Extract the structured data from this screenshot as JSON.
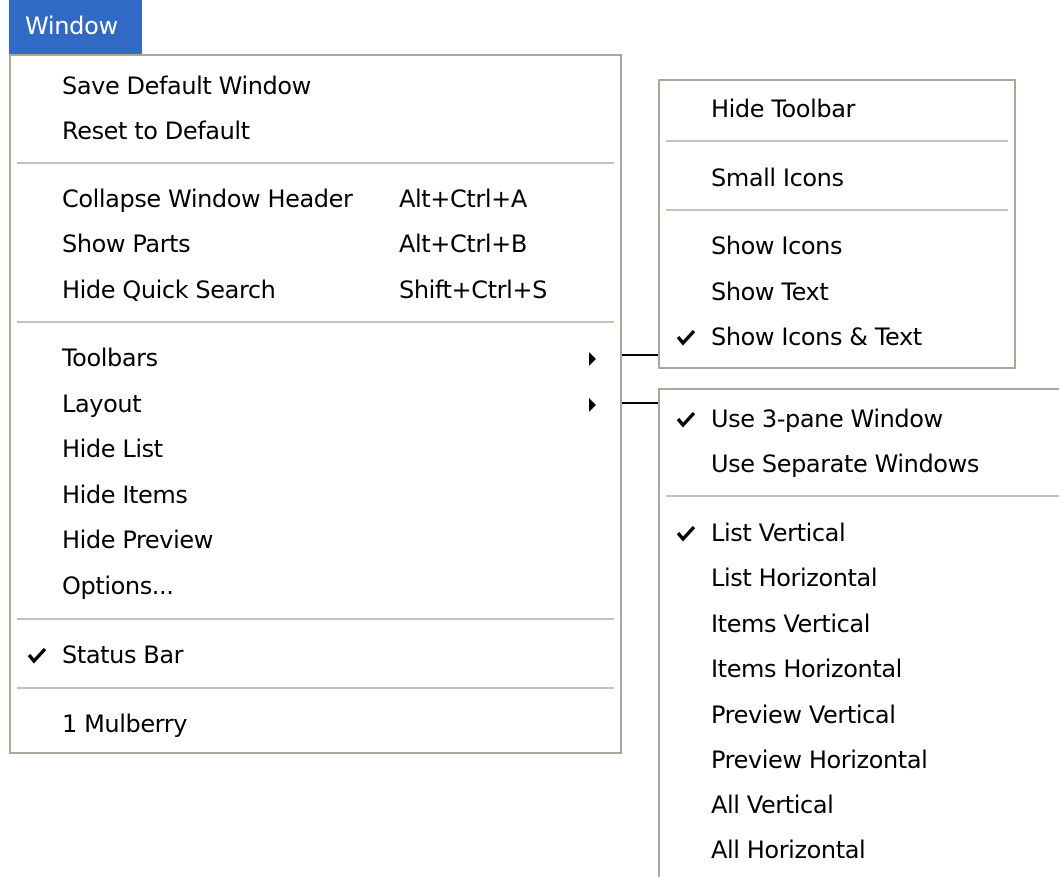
{
  "menubar": {
    "window_label": "Window"
  },
  "main_menu": {
    "save_default_window": "Save Default Window",
    "reset_to_default": "Reset to Default",
    "collapse_window_header": {
      "label": "Collapse Window Header",
      "shortcut": "Alt+Ctrl+A"
    },
    "show_parts": {
      "label": "Show Parts",
      "shortcut": "Alt+Ctrl+B"
    },
    "hide_quick_search": {
      "label": "Hide Quick Search",
      "shortcut": "Shift+Ctrl+S"
    },
    "toolbars": "Toolbars",
    "layout": "Layout",
    "hide_list": "Hide List",
    "hide_items": "Hide Items",
    "hide_preview": "Hide Preview",
    "options": "Options...",
    "status_bar": {
      "label": "Status Bar",
      "checked": true
    },
    "recent_window": "1 Mulberry"
  },
  "toolbars_submenu": {
    "hide_toolbar": "Hide Toolbar",
    "small_icons": "Small Icons",
    "show_icons": "Show Icons",
    "show_text": "Show Text",
    "show_icons_and_text": {
      "label": "Show Icons & Text",
      "checked": true
    }
  },
  "layout_submenu": {
    "use_3_pane_window": {
      "label": "Use 3-pane Window",
      "checked": true
    },
    "use_separate_windows": "Use Separate Windows",
    "list_vertical": {
      "label": "List Vertical",
      "checked": true
    },
    "list_horizontal": "List Horizontal",
    "items_vertical": "Items Vertical",
    "items_horizontal": "Items Horizontal",
    "preview_vertical": "Preview Vertical",
    "preview_horizontal": "Preview Horizontal",
    "all_vertical": "All Vertical",
    "all_horizontal": "All Horizontal"
  },
  "colors": {
    "highlight": "#316ac5",
    "menu_border": "#aca899",
    "separator": "#c4c1b8"
  }
}
